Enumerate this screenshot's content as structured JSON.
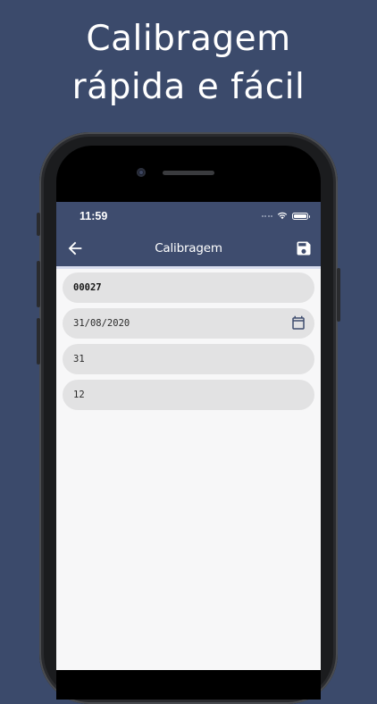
{
  "promo": {
    "line1": "Calibragem",
    "line2": "rápida e fácil"
  },
  "status_bar": {
    "time": "11:59"
  },
  "toolbar": {
    "title": "Calibragem",
    "back_icon": "arrow-left-icon",
    "save_icon": "floppy-disk-icon"
  },
  "form": {
    "fields": [
      {
        "value": "00027"
      },
      {
        "value": "31/08/2020",
        "icon": "calendar-icon"
      },
      {
        "value": "31"
      },
      {
        "value": "12"
      }
    ]
  },
  "colors": {
    "background": "#3b4a6b",
    "app_bar": "#3e4c6e",
    "field_bg": "#e2e2e3",
    "app_bg": "#f7f7f8"
  }
}
